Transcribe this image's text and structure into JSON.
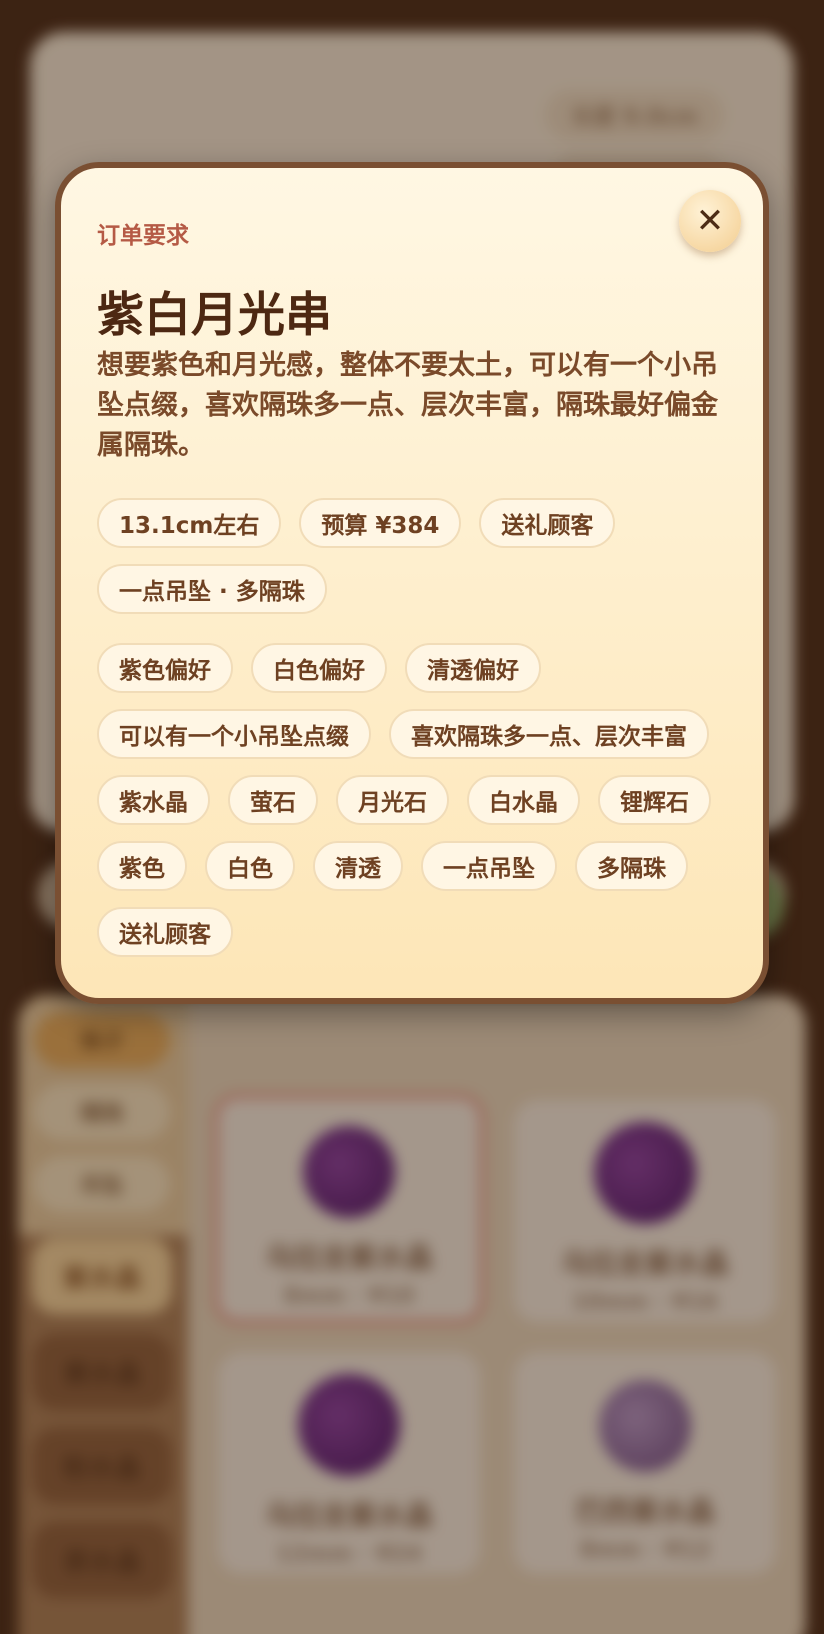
{
  "modal": {
    "kicker": "订单要求",
    "title": "紫白月光串",
    "description": "想要紫色和月光感，整体不要太土，可以有一个小吊坠点缀，喜欢隔珠多一点、层次丰富，隔珠最好偏金属隔珠。",
    "close_label": "✕",
    "summary_tags": [
      "13.1cm左右",
      "预算 ¥384",
      "送礼顾客",
      "一点吊坠 · 多隔珠"
    ],
    "preference_tags": [
      "紫色偏好",
      "白色偏好",
      "清透偏好",
      "可以有一个小吊坠点缀",
      "喜欢隔珠多一点、层次丰富",
      "紫水晶",
      "萤石",
      "月光石",
      "白水晶",
      "锂辉石",
      "紫色",
      "白色",
      "清透",
      "一点吊坠",
      "多隔珠",
      "送礼顾客"
    ]
  },
  "background": {
    "top_chips": [
      "长度 9.0cm",
      ""
    ],
    "side_pills": [
      "珠子",
      "隔珠",
      "吊坠"
    ],
    "categories": [
      "紫水晶",
      "黄水晶",
      "粉水晶",
      "茶水晶"
    ],
    "products": [
      {
        "name": "乌拉圭紫水晶",
        "spec": "8mm · ¥10"
      },
      {
        "name": "乌拉圭紫水晶",
        "spec": "10mm · ¥16"
      },
      {
        "name": "乌拉圭紫水晶",
        "spec": "12mm · ¥24"
      },
      {
        "name": "巴西紫水晶",
        "spec": "8mm · ¥12"
      }
    ]
  }
}
